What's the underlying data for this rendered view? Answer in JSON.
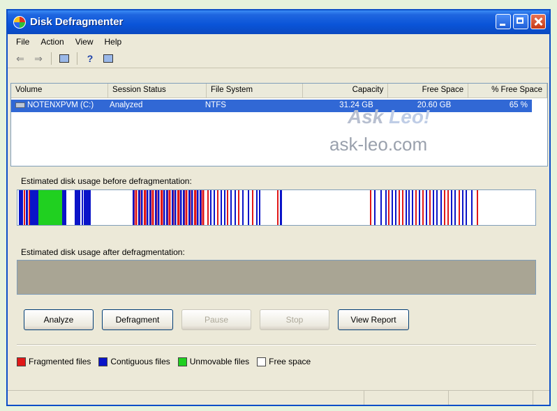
{
  "window": {
    "title": "Disk Defragmenter"
  },
  "menu": [
    "File",
    "Action",
    "View",
    "Help"
  ],
  "toolbar": {
    "icons": [
      "back-icon",
      "forward-icon",
      "show-hide-console-tree-icon",
      "help-icon",
      "properties-icon"
    ]
  },
  "volume_list": {
    "columns": [
      "Volume",
      "Session Status",
      "File System",
      "Capacity",
      "Free Space",
      "% Free Space"
    ],
    "rows": [
      {
        "volume": "NOTENXPVM (C:)",
        "status": "Analyzed",
        "fs": "NTFS",
        "capacity": "31.24 GB",
        "free": "20.60 GB",
        "pct": "65 %"
      }
    ]
  },
  "watermark": {
    "brand_ask": "Ask ",
    "brand_leo": "Leo!",
    "site": "ask-leo.com"
  },
  "before_label": "Estimated disk usage before defragmentation:",
  "after_label": "Estimated disk usage after defragmentation:",
  "buttons": {
    "analyze": "Analyze",
    "defragment": "Defragment",
    "pause": "Pause",
    "stop": "Stop",
    "view_report": "View Report"
  },
  "legend": [
    {
      "label": "Fragmented files",
      "color": "#e01818"
    },
    {
      "label": "Contiguous files",
      "color": "#0a14c8"
    },
    {
      "label": "Unmovable files",
      "color": "#20d020"
    },
    {
      "label": "Free space",
      "color": "#ffffff"
    }
  ],
  "colors": {
    "fragmented": "#e01818",
    "contiguous": "#0a14c8",
    "unmovable": "#20d020",
    "free": "#ffffff"
  }
}
